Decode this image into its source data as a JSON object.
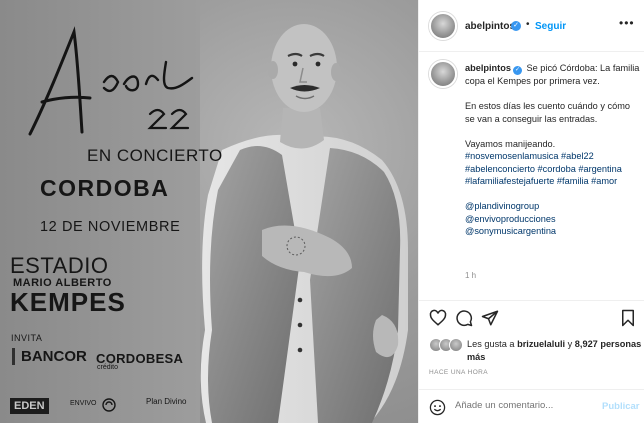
{
  "poster": {
    "signature": "Abel",
    "number": "22",
    "event": "EN CONCIERTO",
    "city": "CORDOBA",
    "date": "12 DE NOVIEMBRE",
    "venue_line1": "ESTADIO",
    "venue_line2": "MARIO ALBERTO",
    "venue_line3": "KEMPES",
    "invita": "INVITA",
    "sponsor1": "BANCOR",
    "sponsor2": "CORDOBESA",
    "sponsor2_sub": "crédito",
    "footer_logos": [
      "EDEN",
      "ENVIVO",
      "sony-music-icon",
      "Plan Divino"
    ]
  },
  "post": {
    "username": "abelpintos",
    "verified_icon": "verified-badge-icon",
    "follow_label": "Seguir",
    "more_icon": "more-options-icon",
    "caption_text": "Se picó Córdoba: La familia copa el Kempes por primera vez.",
    "caption_p2": "En estos días les cuento cuándo y cómo se van a conseguir las entradas.",
    "caption_p3": "Vayamos manijeando.",
    "hashtags": "#nosvemosenlamusica #abel22 #abelenconcierto #cordoba #argentina #lafamiliafestejafuerte #familia #amor",
    "mentions": [
      "@plandivinogroup",
      "@envivoproducciones",
      "@sonymusicargentina"
    ],
    "caption_time": "1 h",
    "actions": [
      "heart-icon",
      "comment-icon",
      "share-icon",
      "bookmark-icon"
    ],
    "likes_prefix": "Les gusta a",
    "likes_user": "brizuelaluli",
    "likes_mid": "y",
    "likes_count": "8,927 personas más",
    "time_ago": "HACE UNA HORA",
    "comment_placeholder": "Añade un comentario...",
    "publish_label": "Publicar"
  },
  "colors": {
    "accent": "#0095f6",
    "hashtag": "#00376b",
    "muted": "#8e8e8e",
    "verified": "#3897f0"
  }
}
